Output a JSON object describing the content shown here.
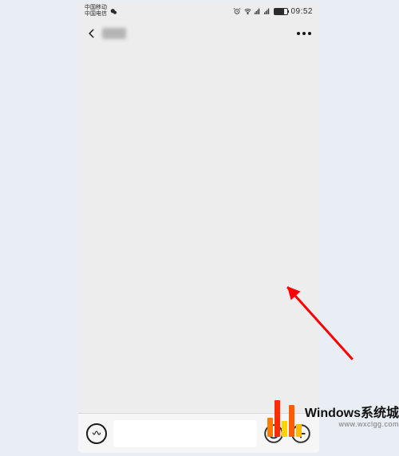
{
  "status_bar": {
    "carrier_line1": "中国移动",
    "carrier_line2": "中国电信",
    "app_icon": "wechat-icon",
    "indicators": {
      "alarm": true,
      "wifi": true,
      "signal1": true,
      "signal2": true,
      "battery_percent": 70
    },
    "clock": "09:52"
  },
  "nav": {
    "back_icon": "chevron-left-icon",
    "contact_name_obscured": true,
    "more_icon": "more-dots-icon"
  },
  "input_bar": {
    "voice_icon": "voice-wave-icon",
    "text_value": "",
    "emoji_icon": "smiley-icon",
    "plus_icon": "plus-circle-icon"
  },
  "overlay": {
    "arrow_color": "#ff0000",
    "watermark_title": "Windows系统城",
    "watermark_url": "www.wxclgg.com"
  },
  "colors": {
    "page_bg": "#e8eef3",
    "chat_bg": "#ededed",
    "input_bar_bg": "#f6f6f6",
    "text_input_bg": "#ffffff",
    "icon_stroke": "#1b1b1b"
  }
}
